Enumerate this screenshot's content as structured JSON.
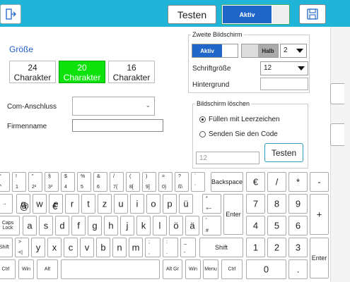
{
  "toolbar": {
    "test_label": "Testen",
    "aktiv_label": "Aktiv"
  },
  "size": {
    "title": "Größe",
    "options": [
      {
        "value": "24",
        "unit": "Charakter",
        "selected": false
      },
      {
        "value": "20",
        "unit": "Charakter",
        "selected": true
      },
      {
        "value": "16",
        "unit": "Charakter",
        "selected": false
      }
    ]
  },
  "com": {
    "label": "Com-Anschluss",
    "value": ""
  },
  "firm": {
    "label": "Firmenname",
    "value": ""
  },
  "second_screen": {
    "title": "Zweite Bildschirm",
    "aktiv_label": "Aktiv",
    "halb_label": "Halb",
    "halb_count": "2",
    "font_size_label": "Schriftgröße",
    "font_size_value": "12",
    "background_label": "Hintergrund"
  },
  "clear_screen": {
    "title": "Bildschirm löschen",
    "option_fill": "Füllen mit Leerzeichen",
    "option_code": "Senden Sie den Code",
    "code_placeholder": "12",
    "test_label": "Testen"
  },
  "keyboard": {
    "row1": [
      {
        "t": "°",
        "b": "^"
      },
      {
        "t": "!",
        "b": "1"
      },
      {
        "t": "\"",
        "b": "2²"
      },
      {
        "t": "§",
        "b": "3³"
      },
      {
        "t": "$",
        "b": "4"
      },
      {
        "t": "%",
        "b": "5"
      },
      {
        "t": "&",
        "b": "6"
      },
      {
        "t": "/",
        "b": "7{"
      },
      {
        "t": "(",
        "b": "8["
      },
      {
        "t": ")",
        "b": "9]"
      },
      {
        "t": "=",
        "b": "0}"
      },
      {
        "t": "?",
        "b": "ß\\"
      },
      {
        "t": "`",
        "b": "´"
      }
    ],
    "backspace": "Backspace",
    "tab": "→",
    "row2": [
      "q@",
      "w",
      "e€",
      "r",
      "t",
      "z",
      "u",
      "i",
      "o",
      "p",
      "ü"
    ],
    "plus_key": {
      "t": "*",
      "b": "+~"
    },
    "enter": "Enter",
    "caps": "Caps Lock",
    "row3": [
      "a",
      "s",
      "d",
      "f",
      "g",
      "h",
      "j",
      "k",
      "l",
      "ö",
      "ä"
    ],
    "hash_key": {
      "t": "'",
      "b": "#"
    },
    "shift": "Shift",
    "angle_key": {
      "t": ">",
      "b": "<|"
    },
    "row4": [
      "y",
      "x",
      "c",
      "v",
      "b",
      "n",
      "m"
    ],
    "row4_punct": [
      {
        "t": ";",
        "b": ","
      },
      {
        "t": ":",
        "b": "."
      },
      {
        "t": "_",
        "b": "-"
      }
    ],
    "ctrl": "Ctrl",
    "win": "Win",
    "alt": "Alt",
    "altgr": "Alt Gr",
    "menu": "Menu",
    "numpad": {
      "top": [
        "€",
        "/",
        "*",
        "-"
      ],
      "r1": [
        "7",
        "8",
        "9"
      ],
      "r2": [
        "4",
        "5",
        "6"
      ],
      "r3": [
        "1",
        "2",
        "3"
      ],
      "zero": "0",
      "dot": ".",
      "plus": "+",
      "enter": "Enter"
    }
  }
}
